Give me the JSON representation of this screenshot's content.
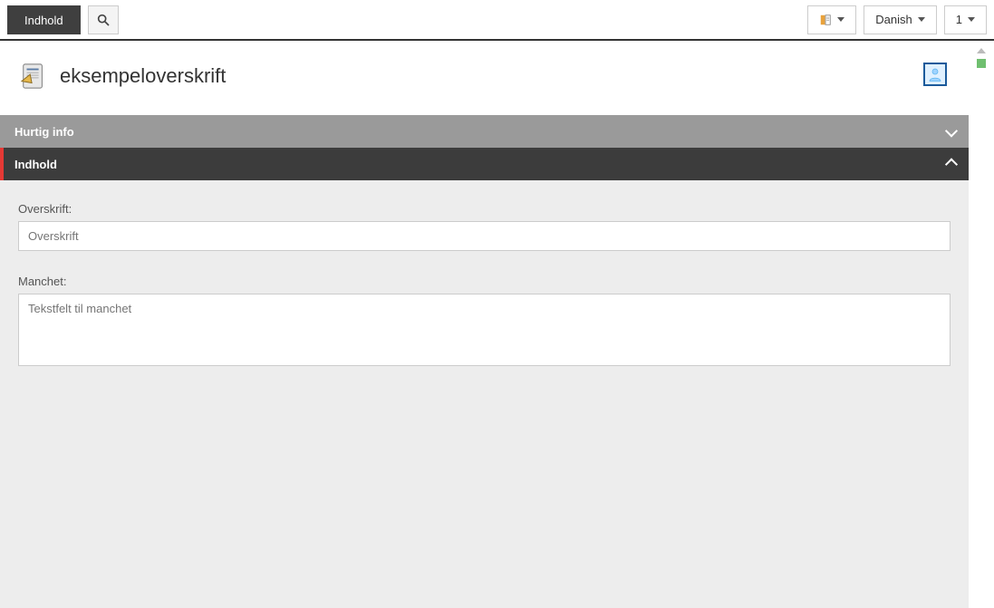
{
  "topbar": {
    "content_tab": "Indhold",
    "language_label": "Danish",
    "version_label": "1"
  },
  "page": {
    "title": "eksempeloverskrift"
  },
  "accordion": {
    "quick_info_label": "Hurtig info",
    "content_label": "Indhold"
  },
  "fields": {
    "overskrift": {
      "label": "Overskrift:",
      "placeholder": "Overskrift",
      "value": ""
    },
    "manchet": {
      "label": "Manchet:",
      "placeholder": "Tekstfelt til manchet",
      "value": ""
    }
  }
}
